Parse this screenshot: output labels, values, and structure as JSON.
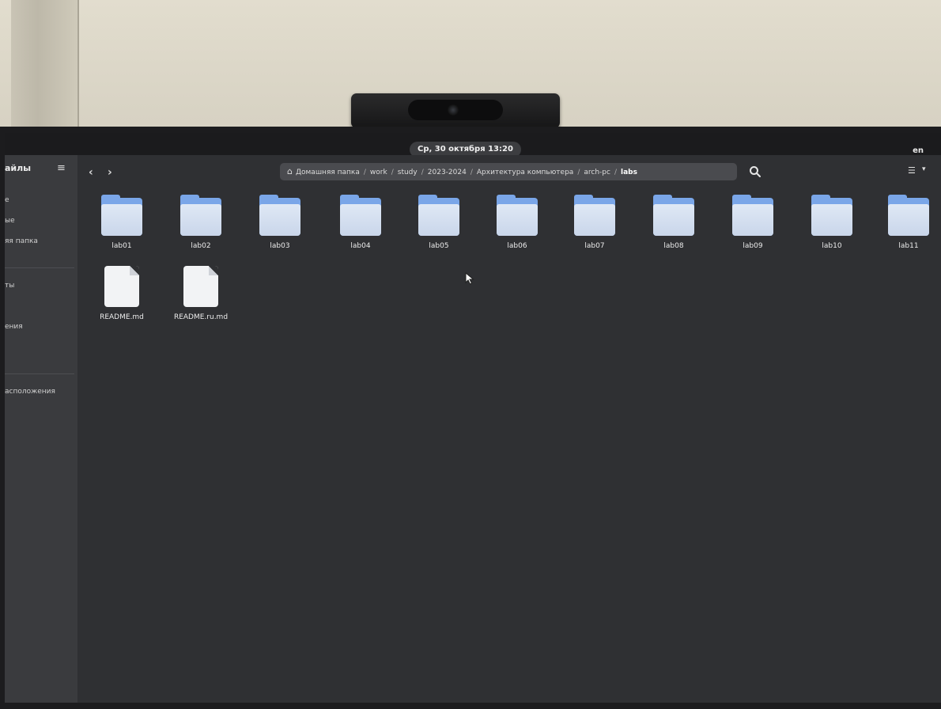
{
  "topbar": {
    "clock": "Ср, 30 октября 13:20",
    "language": "en"
  },
  "sidebar": {
    "title": "айлы",
    "items": [
      {
        "label": "е"
      },
      {
        "label": "ые"
      },
      {
        "label": "яя папка"
      },
      {
        "label": "ты"
      },
      {
        "label": "ения"
      },
      {
        "label": "асположения"
      }
    ]
  },
  "path": {
    "segments": [
      "Домашняя папка",
      "work",
      "study",
      "2023-2024",
      "Архитектура компьютера",
      "arch-pc"
    ],
    "current": "labs"
  },
  "files": [
    {
      "name": "lab01",
      "type": "folder"
    },
    {
      "name": "lab02",
      "type": "folder"
    },
    {
      "name": "lab03",
      "type": "folder"
    },
    {
      "name": "lab04",
      "type": "folder"
    },
    {
      "name": "lab05",
      "type": "folder"
    },
    {
      "name": "lab06",
      "type": "folder"
    },
    {
      "name": "lab07",
      "type": "folder"
    },
    {
      "name": "lab08",
      "type": "folder"
    },
    {
      "name": "lab09",
      "type": "folder"
    },
    {
      "name": "lab10",
      "type": "folder"
    },
    {
      "name": "lab11",
      "type": "folder"
    },
    {
      "name": "README.md",
      "type": "file"
    },
    {
      "name": "README.ru.md",
      "type": "file"
    }
  ],
  "icons": {
    "back": "chevron-left-icon",
    "forward": "chevron-right-icon",
    "home": "home-icon",
    "menu": "hamburger-menu-icon",
    "more": "kebab-menu-icon",
    "search": "search-icon",
    "view": "list-view-icon"
  },
  "colors": {
    "folder_accent": "#7aa6e8",
    "window_bg": "#2f3033",
    "sidebar_bg": "#3a3b3e"
  }
}
